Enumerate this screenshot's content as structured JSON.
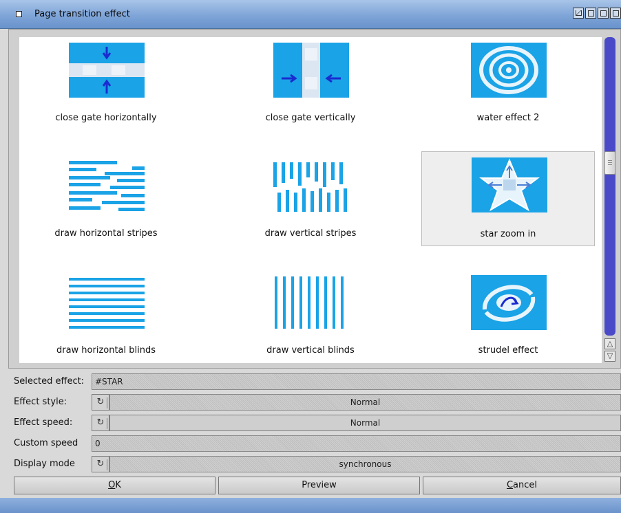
{
  "window": {
    "title": "Page transition effect",
    "title_gadgets": [
      "zoom-gadget-icon",
      "depth-gadget-icon",
      "iconify-gadget-icon",
      "snapshot-gadget-icon"
    ]
  },
  "effects": [
    {
      "label": "close gate horizontally",
      "icon": "close-gate-horizontally-icon"
    },
    {
      "label": "close gate vertically",
      "icon": "close-gate-vertically-icon"
    },
    {
      "label": "water effect 2",
      "icon": "water-effect-icon"
    },
    {
      "label": "draw horizontal stripes",
      "icon": "horizontal-stripes-icon"
    },
    {
      "label": "draw vertical stripes",
      "icon": "vertical-stripes-icon"
    },
    {
      "label": "star zoom in",
      "icon": "star-zoom-icon",
      "selected": true
    },
    {
      "label": "draw horizontal blinds",
      "icon": "horizontal-blinds-icon"
    },
    {
      "label": "draw vertical blinds",
      "icon": "vertical-blinds-icon"
    },
    {
      "label": "strudel effect",
      "icon": "strudel-effect-icon"
    }
  ],
  "form": {
    "selected_effect": {
      "label": "Selected effect:",
      "value": "#STAR"
    },
    "effect_style": {
      "label": "Effect style:",
      "value": "Normal"
    },
    "effect_speed": {
      "label": "Effect speed:",
      "value": "Normal"
    },
    "custom_speed": {
      "label": "Custom speed",
      "value": "0"
    },
    "display_mode": {
      "label": "Display mode",
      "value": "synchronous"
    }
  },
  "buttons": {
    "ok": {
      "pre": "",
      "key": "O",
      "post": "K"
    },
    "preview": {
      "label": "Preview"
    },
    "cancel": {
      "pre": "",
      "key": "C",
      "post": "ancel"
    }
  },
  "colors": {
    "accent": "#1aa3e6",
    "title_bar": "#7fa5d8",
    "scroll_track": "#4a4ac8"
  }
}
